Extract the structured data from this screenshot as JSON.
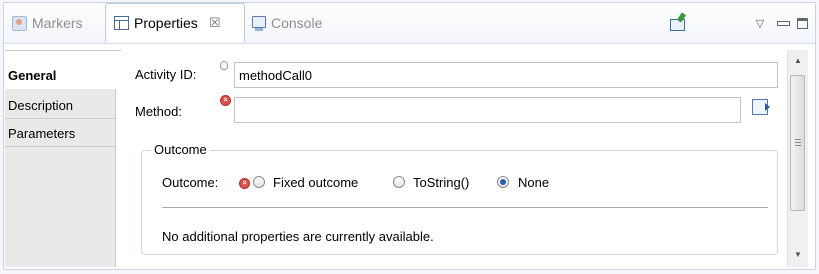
{
  "tabs": [
    {
      "label": "Markers",
      "icon": "markers-icon"
    },
    {
      "label": "Properties",
      "icon": "properties-icon",
      "active": true
    },
    {
      "label": "Console",
      "icon": "console-icon"
    }
  ],
  "close_glyph": "☒",
  "sidebar": {
    "items": [
      {
        "label": "General",
        "active": true
      },
      {
        "label": "Description"
      },
      {
        "label": "Parameters"
      }
    ]
  },
  "form": {
    "activity_id_label": "Activity ID:",
    "activity_id_value": "methodCall0",
    "method_label": "Method:",
    "method_value": ""
  },
  "outcome": {
    "group_title": "Outcome",
    "label": "Outcome:",
    "options": [
      {
        "label": "Fixed outcome",
        "checked": false
      },
      {
        "label": "ToString()",
        "checked": false
      },
      {
        "label": "None",
        "checked": true
      }
    ],
    "message": "No additional properties are currently available."
  },
  "colors": {
    "accent": "#2a5fb8",
    "error": "#d9534f",
    "border": "#c9d3e2"
  }
}
